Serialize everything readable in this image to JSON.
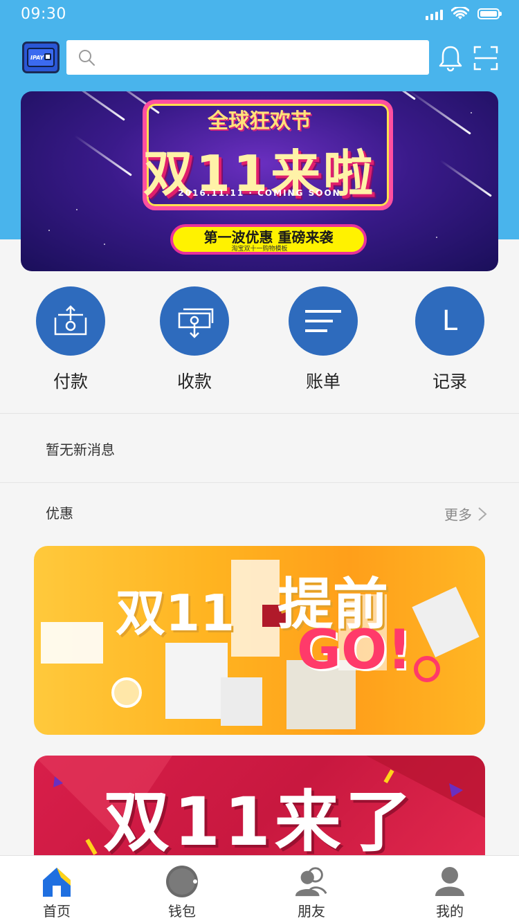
{
  "status_bar": {
    "time": "09:30"
  },
  "header": {
    "logo_text": "IPAY",
    "search": {
      "placeholder": "",
      "value": ""
    }
  },
  "hero_banner": {
    "top_text": "全球狂欢节",
    "title": "双11来啦",
    "date_line": "2016.11.11 · COMING SOON",
    "pill_text": "第一波优惠 重磅来袭",
    "sub_text": "淘宝双十一购物模板"
  },
  "quick_actions": [
    {
      "label": "付款",
      "icon": "pay-icon"
    },
    {
      "label": "收款",
      "icon": "receive-icon"
    },
    {
      "label": "账单",
      "icon": "bill-icon"
    },
    {
      "label": "记录",
      "icon": "record-icon",
      "glyph": "L"
    }
  ],
  "notice": {
    "text": "暂无新消息"
  },
  "offers": {
    "title": "优惠",
    "more_label": "更多",
    "promo1": {
      "text1": "双11",
      "text2": "提前",
      "text3": "GO!"
    },
    "promo2": {
      "text": "双11来了"
    }
  },
  "tab_bar": [
    {
      "label": "首页",
      "icon": "home-icon"
    },
    {
      "label": "钱包",
      "icon": "wallet-icon"
    },
    {
      "label": "朋友",
      "icon": "friends-icon"
    },
    {
      "label": "我的",
      "icon": "profile-icon"
    }
  ],
  "colors": {
    "header_blue": "#49b4ec",
    "action_blue": "#2e6bbd",
    "background": "#f5f5f5",
    "home_active": "#1f6fe0",
    "home_roof_accent": "#ffd31a"
  }
}
